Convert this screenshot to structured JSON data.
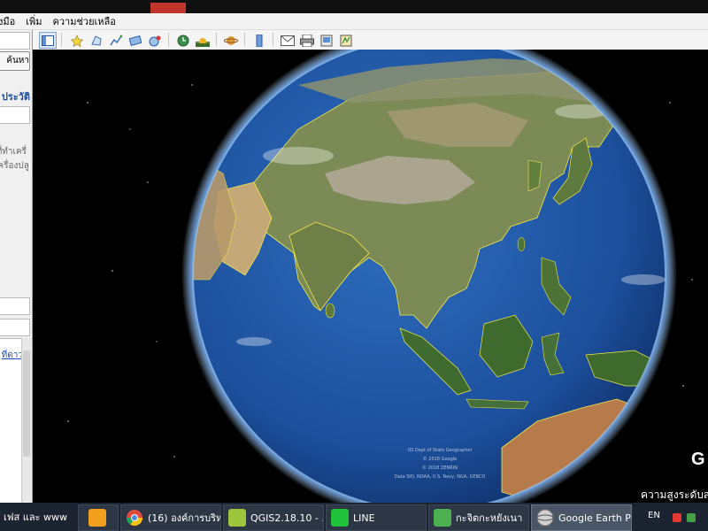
{
  "menu": {
    "items": [
      "งมือ",
      "เพิ่ม",
      "ความช่วยเหลือ"
    ]
  },
  "left_panel": {
    "search_button": "ค้นหา",
    "history_label": "ประวัติ",
    "hint_line1": "ที่ทำเครื่",
    "hint_line2": "เครื่องปลู",
    "places_link": "ที่ดาว"
  },
  "toolbar": {
    "buttons": [
      {
        "icon": "sidebar-toggle-icon",
        "active": true
      },
      {
        "icon": "placemark-icon"
      },
      {
        "icon": "polygon-icon"
      },
      {
        "icon": "path-icon"
      },
      {
        "icon": "overlay-icon"
      },
      {
        "icon": "record-tour-icon"
      },
      {
        "icon": "historical-imagery-icon"
      },
      {
        "icon": "sunlight-icon"
      },
      {
        "icon": "planets-icon"
      },
      {
        "icon": "ruler-icon"
      },
      {
        "icon": "email-icon"
      },
      {
        "icon": "print-icon"
      },
      {
        "icon": "save-image-icon"
      },
      {
        "icon": "view-in-maps-icon"
      }
    ]
  },
  "globe": {
    "attribution": [
      "US Dept of State Geographer",
      "© 2018 Google",
      "© 2018 ZENRIN",
      "Data SIO, NOAA, U.S. Navy, NGA, GEBCO"
    ],
    "logo": "G",
    "altitude_label": "ความสูงระดับส"
  },
  "taskbar": {
    "left_label": "เฟส และ www",
    "tasks": [
      {
        "label": "",
        "icon": "media-player-icon",
        "color": "#f2a01e"
      },
      {
        "label": "(16) องค์การบริห...",
        "icon": "chrome-icon",
        "color": "#dd4b3e"
      },
      {
        "label": "QGIS2.18.10 - ...",
        "icon": "qgis-icon",
        "color": "#9bc53d"
      },
      {
        "label": "LINE",
        "icon": "line-icon",
        "color": "#20c23a"
      },
      {
        "label": "กะจิตกะหยังเนา",
        "icon": "contacts-icon",
        "color": "#4caf50"
      },
      {
        "label": "Google Earth Pro",
        "icon": "google-earth-icon",
        "color": "#8a8a8a"
      }
    ],
    "language": "EN"
  },
  "colors": {
    "menu_bg": "#f3f3f3",
    "ocean": "#1d4f9e",
    "border_yellow": "#f0e84a",
    "taskbar_bg": "#1b2430"
  }
}
